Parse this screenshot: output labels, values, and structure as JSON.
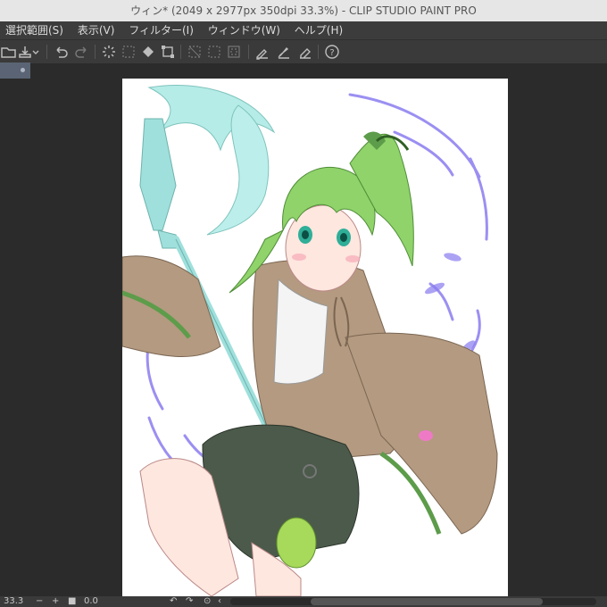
{
  "window": {
    "title": "ウィン* (2049 x 2977px 350dpi 33.3%)  - CLIP STUDIO PAINT PRO"
  },
  "menu": {
    "items": [
      "選択範囲(S)",
      "表示(V)",
      "フィルター(I)",
      "ウィンドウ(W)",
      "ヘルプ(H)"
    ]
  },
  "status": {
    "zoom": "33.3",
    "angle": "0.0"
  },
  "colors": {
    "hair": "#8fd36a",
    "coat": "#b39a80",
    "skirt": "#4b5a4a",
    "staff": "#a6e6e2",
    "petals": "#8a7cf0"
  }
}
